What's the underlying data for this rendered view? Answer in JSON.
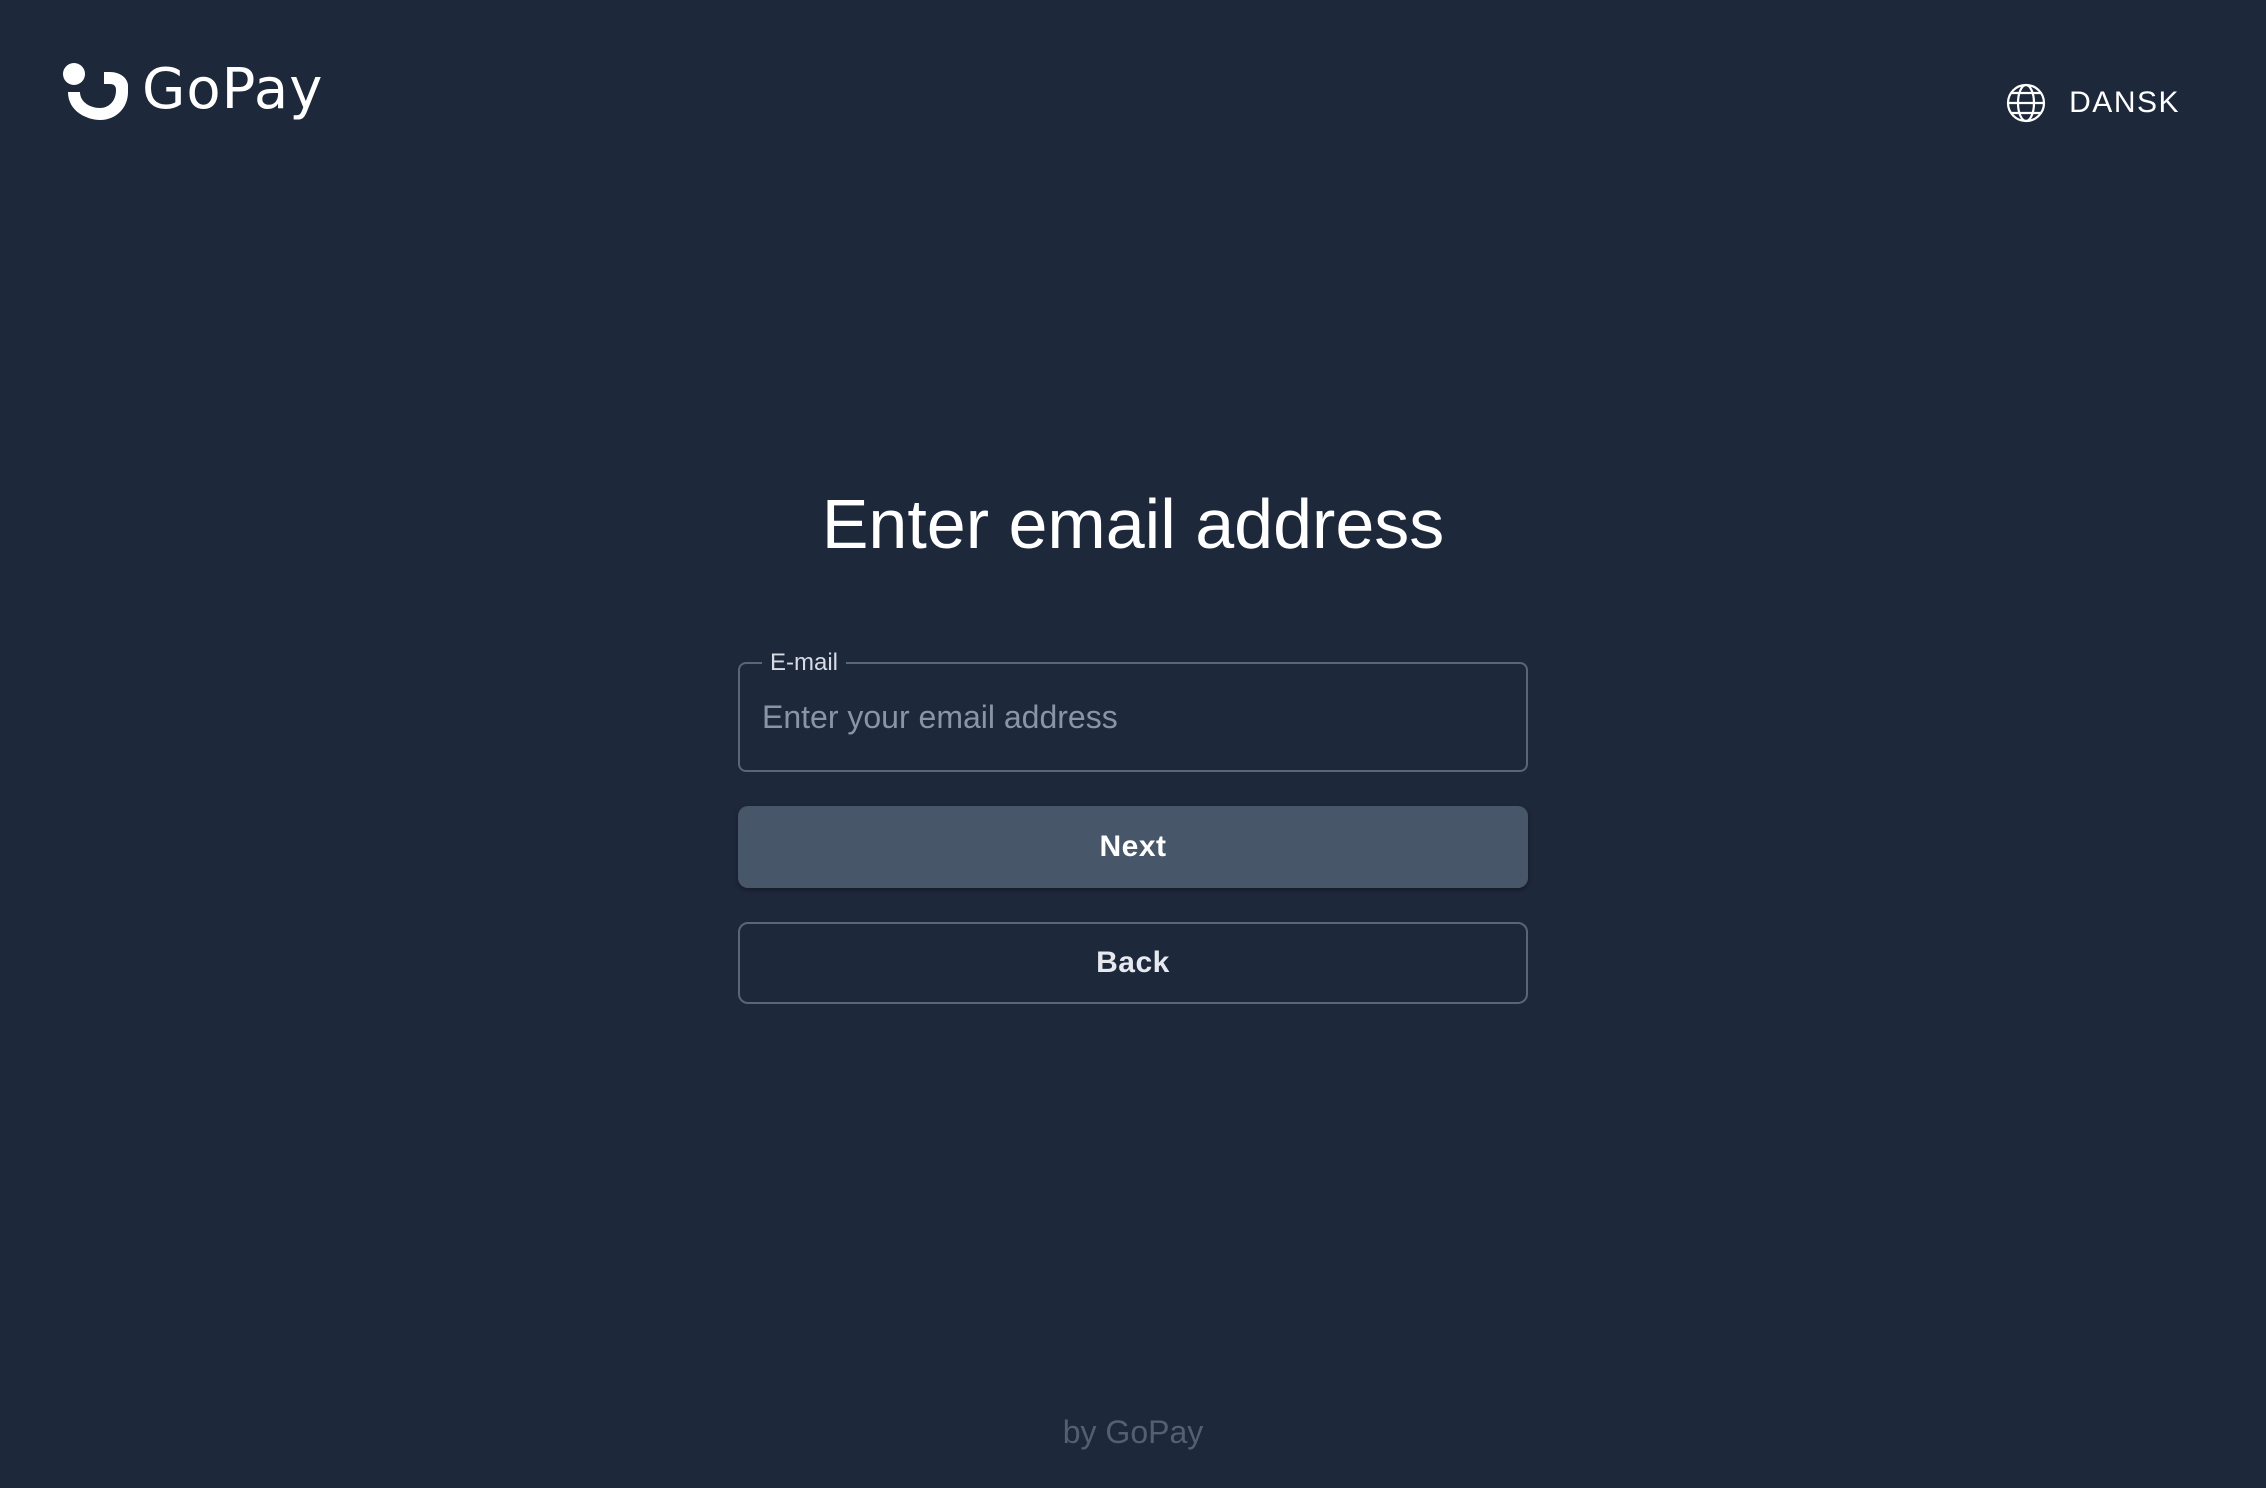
{
  "header": {
    "logo_text": "GoPay",
    "language_label": "DANSK"
  },
  "main": {
    "title": "Enter email address",
    "email_field": {
      "label": "E-mail",
      "value": "",
      "placeholder": "Enter your email address"
    },
    "next_label": "Next",
    "back_label": "Back"
  },
  "footer": {
    "text": "by GoPay"
  },
  "icons": {
    "logo": "gopay-logo-icon",
    "language": "globe-icon"
  },
  "colors": {
    "background": "#1e283b",
    "primary_button": "#485669",
    "border": "#5a6578",
    "text": "#ffffff",
    "footer_text": "#555f70"
  }
}
